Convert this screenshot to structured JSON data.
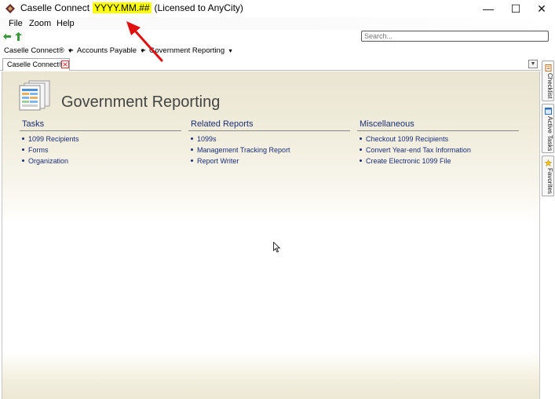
{
  "window": {
    "app_name": "Caselle Connect",
    "version": "YYYY.MM.##",
    "license": "(Licensed to AnyCity)",
    "minimize_glyph": "—",
    "maximize_glyph": "☐",
    "close_glyph": "✕"
  },
  "menu": [
    "File",
    "Zoom",
    "Help"
  ],
  "toolbar": {
    "search_placeholder": "Search..."
  },
  "breadcrumb": {
    "items": [
      "Caselle Connect®",
      "Accounts Payable",
      "Government Reporting"
    ],
    "separator": ">",
    "caret": "▼"
  },
  "tabs": {
    "active_label": "Caselle Connect®",
    "menu_glyph": "▼"
  },
  "page": {
    "title": "Government Reporting",
    "sections": [
      {
        "title": "Tasks",
        "items": [
          "1099 Recipients",
          "Forms",
          "Organization"
        ]
      },
      {
        "title": "Related Reports",
        "items": [
          "1099s",
          "Management Tracking Report",
          "Report Writer"
        ]
      },
      {
        "title": "Miscellaneous",
        "items": [
          "Checkout 1099 Recipients",
          "Convert Year-end Tax Information",
          "Create Electronic 1099 File"
        ]
      }
    ]
  },
  "side_tabs": [
    "Checklist",
    "Active Tasks",
    "Favorites"
  ],
  "colors": {
    "accent_link": "#1a2e7a",
    "version_highlight": "#ffff00",
    "annotation_arrow": "#e01010"
  },
  "icons": {
    "app": "caselle-diamond-icon",
    "back": "back-arrow-icon",
    "up": "up-arrow-icon",
    "page": "report-pages-icon",
    "tab_close": "close-icon",
    "pointer": "mouse-pointer-icon"
  }
}
